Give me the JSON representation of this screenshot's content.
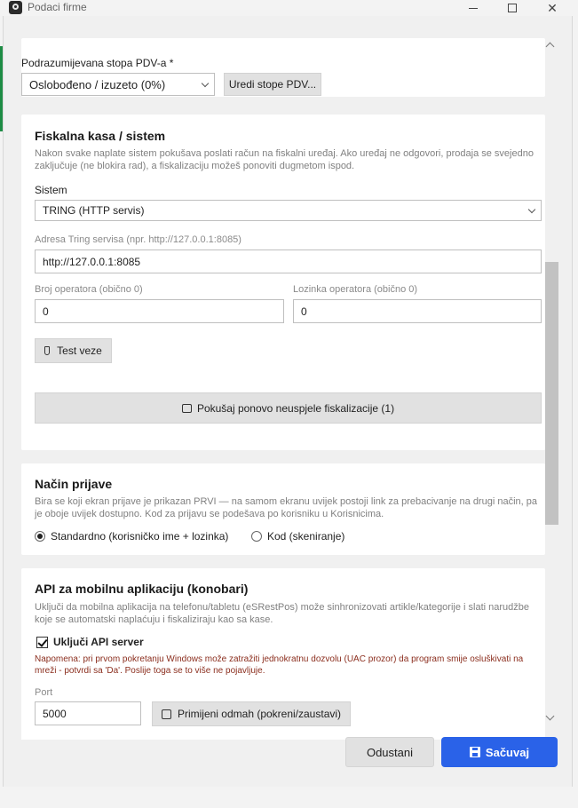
{
  "window": {
    "title": "Podaci firme"
  },
  "vat": {
    "label": "Podrazumijevana stopa PDV-a *",
    "selected": "Oslobođeno / izuzeto (0%)",
    "edit_button": "Uredi stope PDV..."
  },
  "fiscal": {
    "heading": "Fiskalna kasa / sistem",
    "description": "Nakon svake naplate sistem pokušava poslati račun na fiskalni uređaj. Ako uređaj ne odgovori, prodaja se svejedno zaključuje (ne blokira rad), a fiskalizaciju možeš ponoviti dugmetom ispod.",
    "system_label": "Sistem",
    "system_selected": "TRING (HTTP servis)",
    "address_label": "Adresa Tring servisa (npr. http://127.0.0.1:8085)",
    "address_value": "http://127.0.0.1:8085",
    "operator_label": "Broj operatora (obično 0)",
    "operator_value": "0",
    "password_label": "Lozinka operatora (obično 0)",
    "password_value": "0",
    "test_button": "Test veze",
    "retry_button": "Pokušaj ponovo neuspjele fiskalizacije (1)"
  },
  "login": {
    "heading": "Način prijave",
    "description": "Bira se koji ekran prijave je prikazan PRVI — na samom ekranu uvijek postoji link za prebacivanje na drugi način, pa je oboje uvijek dostupno. Kod za prijavu se podešava po korisniku u Korisnicima.",
    "option_standard": "Standardno (korisničko ime + lozinka)",
    "option_code": "Kod (skeniranje)",
    "selected": "standard"
  },
  "api": {
    "heading": "API za mobilnu aplikaciju (konobari)",
    "description": "Uključi da mobilna aplikacija na telefonu/tabletu (eSRestPos) može sinhronizovati artikle/kategorije i slati narudžbe koje se automatski naplaćuju i fiskaliziraju kao sa kase.",
    "enable_label": "Uključi API server",
    "enabled": true,
    "note": "Napomena: pri prvom pokretanju Windows može zatražiti jednokratnu dozvolu (UAC prozor) da program smije osluškivati na mreži - potvrdi sa 'Da'. Poslije toga se to više ne pojavljuje.",
    "port_label": "Port",
    "port_value": "5000",
    "apply_button": "Primijeni odmah (pokreni/zaustavi)"
  },
  "footer": {
    "cancel": "Odustani",
    "save": "Sačuvaj"
  },
  "colors": {
    "accent": "#2a62e8",
    "note": "#8b2e1e"
  }
}
